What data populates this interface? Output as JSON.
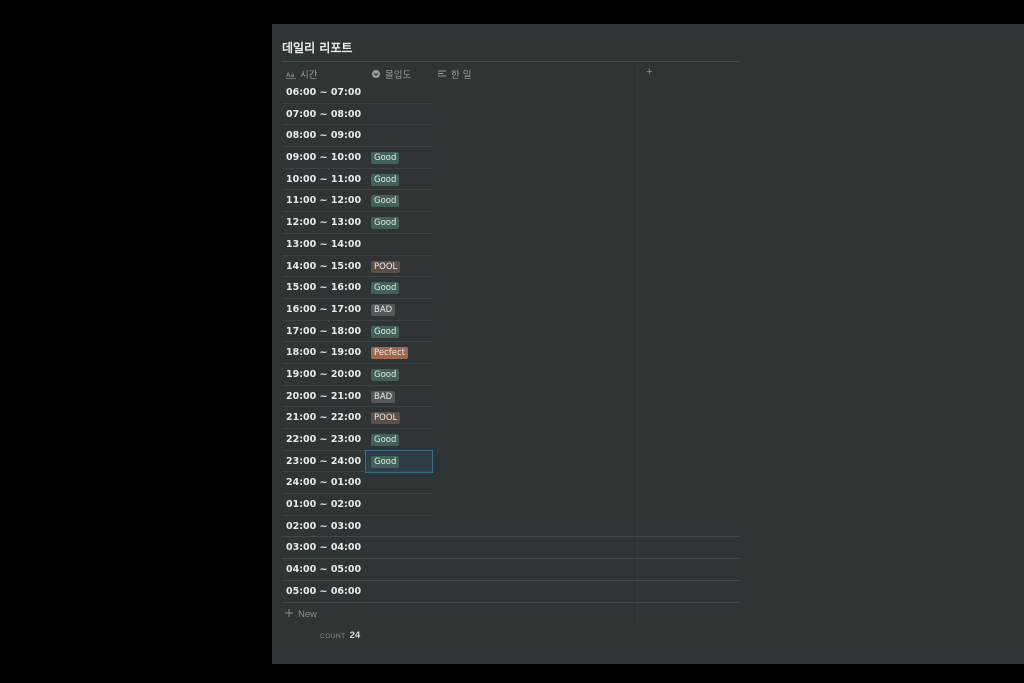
{
  "title": "데일리 리포트",
  "columns": {
    "time": "시간",
    "focus": "몰입도",
    "did": "한 일",
    "add": "+"
  },
  "tag_colors": {
    "Good": "#41615a",
    "POOL": "#5c5049",
    "BAD": "#55585a",
    "Pecfect": "#a3674a"
  },
  "rows": [
    {
      "time": "06:00 ~ 07:00",
      "focus": ""
    },
    {
      "time": "07:00 ~ 08:00",
      "focus": ""
    },
    {
      "time": "08:00 ~ 09:00",
      "focus": ""
    },
    {
      "time": "09:00 ~ 10:00",
      "focus": "Good"
    },
    {
      "time": "10:00 ~ 11:00",
      "focus": "Good"
    },
    {
      "time": "11:00 ~ 12:00",
      "focus": "Good"
    },
    {
      "time": "12:00 ~ 13:00",
      "focus": "Good"
    },
    {
      "time": "13:00 ~ 14:00",
      "focus": ""
    },
    {
      "time": "14:00 ~ 15:00",
      "focus": "POOL"
    },
    {
      "time": "15:00 ~ 16:00",
      "focus": "Good"
    },
    {
      "time": "16:00 ~ 17:00",
      "focus": "BAD"
    },
    {
      "time": "17:00 ~ 18:00",
      "focus": "Good"
    },
    {
      "time": "18:00 ~ 19:00",
      "focus": "Pecfect"
    },
    {
      "time": "19:00 ~ 20:00",
      "focus": "Good"
    },
    {
      "time": "20:00 ~ 21:00",
      "focus": "BAD"
    },
    {
      "time": "21:00 ~ 22:00",
      "focus": "POOL"
    },
    {
      "time": "22:00 ~ 23:00",
      "focus": "Good"
    },
    {
      "time": "23:00 ~ 24:00",
      "focus": "Good",
      "selected": true
    },
    {
      "time": "24:00 ~ 01:00",
      "focus": ""
    },
    {
      "time": "01:00 ~ 02:00",
      "focus": ""
    },
    {
      "time": "02:00 ~ 03:00",
      "focus": ""
    },
    {
      "time": "03:00 ~ 04:00",
      "focus": ""
    },
    {
      "time": "04:00 ~ 05:00",
      "focus": ""
    },
    {
      "time": "05:00 ~ 06:00",
      "focus": ""
    }
  ],
  "footer": {
    "new_label": "New",
    "count_label": "COUNT",
    "count_value": "24"
  }
}
